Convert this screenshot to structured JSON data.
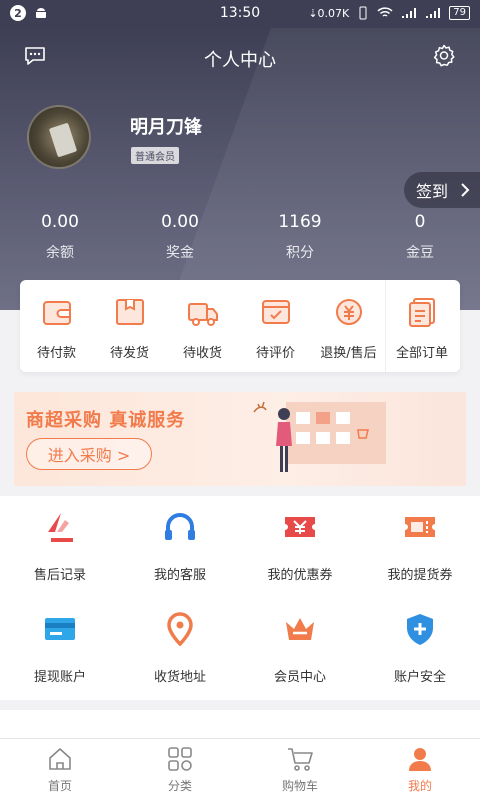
{
  "status_bar": {
    "notification_count": "2",
    "time": "13:50",
    "net_speed": "0.07K",
    "battery": "79"
  },
  "header": {
    "title": "个人中心"
  },
  "profile": {
    "username": "明月刀锋",
    "member_level": "普通会员",
    "signin_label": "签到"
  },
  "stats": [
    {
      "value": "0.00",
      "label": "余额"
    },
    {
      "value": "0.00",
      "label": "奖金"
    },
    {
      "value": "1169",
      "label": "积分"
    },
    {
      "value": "0",
      "label": "金豆"
    }
  ],
  "orders": [
    {
      "label": "待付款",
      "icon": "wallet-icon"
    },
    {
      "label": "待发货",
      "icon": "package-icon"
    },
    {
      "label": "待收货",
      "icon": "truck-icon"
    },
    {
      "label": "待评价",
      "icon": "review-icon"
    },
    {
      "label": "退换/售后",
      "icon": "refund-icon"
    },
    {
      "label": "全部订单",
      "icon": "orders-list-icon"
    }
  ],
  "banner": {
    "slogan": "商超采购 真诚服务",
    "cta": "进入采购 >"
  },
  "services": [
    {
      "label": "售后记录",
      "icon": "after-sales-icon"
    },
    {
      "label": "我的客服",
      "icon": "headset-icon"
    },
    {
      "label": "我的优惠券",
      "icon": "coupon-icon"
    },
    {
      "label": "我的提货券",
      "icon": "voucher-icon"
    },
    {
      "label": "提现账户",
      "icon": "card-icon"
    },
    {
      "label": "收货地址",
      "icon": "location-icon"
    },
    {
      "label": "会员中心",
      "icon": "crown-icon"
    },
    {
      "label": "账户安全",
      "icon": "shield-icon"
    }
  ],
  "tabs": [
    {
      "label": "首页",
      "icon": "home-icon",
      "active": false
    },
    {
      "label": "分类",
      "icon": "category-icon",
      "active": false
    },
    {
      "label": "购物车",
      "icon": "cart-icon",
      "active": false
    },
    {
      "label": "我的",
      "icon": "user-icon",
      "active": true
    }
  ],
  "colors": {
    "accent": "#f27b4c",
    "header_dark": "#3e3f54",
    "blue": "#2f7de1",
    "red": "#e84a4a"
  }
}
